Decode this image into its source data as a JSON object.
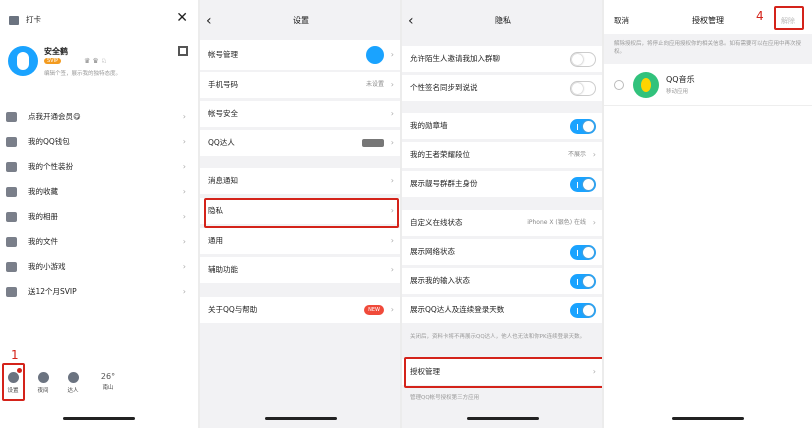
{
  "p1": {
    "title": "打卡",
    "name": "安全鹤",
    "level": "SVIP",
    "tags": "♛ ♛ ♘",
    "sign": "编辑个签，展示我的独特态度。",
    "menu": [
      {
        "label": "点我开通会员😋"
      },
      {
        "label": "我的QQ钱包"
      },
      {
        "label": "我的个性装扮"
      },
      {
        "label": "我的收藏"
      },
      {
        "label": "我的相册"
      },
      {
        "label": "我的文件"
      },
      {
        "label": "我的小游戏"
      },
      {
        "label": "送12个月SVIP"
      }
    ],
    "bottom": [
      {
        "label": "设置"
      },
      {
        "label": "夜间"
      },
      {
        "label": "达人"
      },
      {
        "label": "南山",
        "temp": "26°"
      }
    ],
    "step": "1"
  },
  "p2": {
    "title": "设置",
    "rows": [
      {
        "label": "帐号管理"
      },
      {
        "label": "手机号码",
        "value": "未设置"
      },
      {
        "label": "帐号安全"
      },
      {
        "label": "QQ达人"
      },
      {
        "label": "消息通知"
      },
      {
        "label": "隐私"
      },
      {
        "label": "通用"
      },
      {
        "label": "辅助功能"
      },
      {
        "label": "关于QQ与帮助",
        "badge": "NEW"
      }
    ],
    "step": "2"
  },
  "p3": {
    "title": "隐私",
    "rows": [
      {
        "label": "允许陌生人邀请我加入群聊"
      },
      {
        "label": "个性签名同步到说说"
      },
      {
        "label": "我的勋章墙"
      },
      {
        "label": "我的王者荣耀段位",
        "value": "不展示"
      },
      {
        "label": "展示靓号群群主身份"
      },
      {
        "label": "自定义在线状态",
        "value": "iPhone X (银色) 在线"
      },
      {
        "label": "展示网络状态"
      },
      {
        "label": "展示我的输入状态"
      },
      {
        "label": "展示QQ达人及连续登录天数"
      },
      {
        "label": "授权管理"
      }
    ],
    "note1": "关闭后，资料卡将不再展示QQ达人，他人也无法和你PK连续登录天数。",
    "note2": "管理QQ帐号授权第三方应用",
    "step": "3"
  },
  "p4": {
    "cancel": "取消",
    "title": "授权管理",
    "remove": "解除",
    "desc": "解除授权后，将停止向应用授权你的相关信息。如有需要可以在应用中再次授权。",
    "app_name": "QQ音乐",
    "app_type": "移动应用",
    "step": "4"
  }
}
